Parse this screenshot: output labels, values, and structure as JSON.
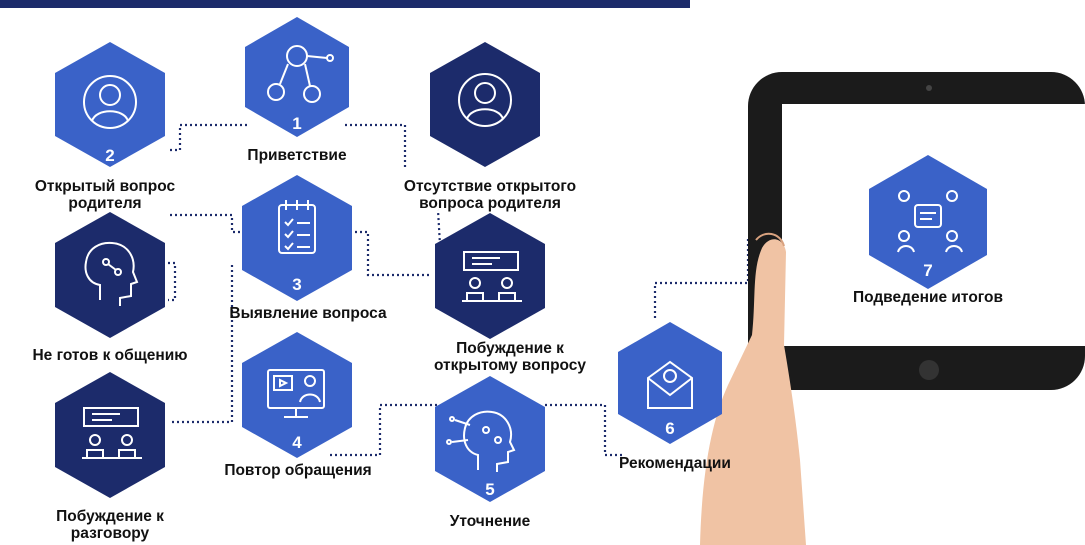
{
  "colors": {
    "accent_light": "#3a62c8",
    "accent_dark": "#1c2b6b",
    "line": "#1c2b6b"
  },
  "nodes": {
    "n1": {
      "number": "1",
      "label": "Приветствие",
      "icon": "people-network-icon"
    },
    "n2": {
      "number": "2",
      "label_line1": "Открытый вопрос",
      "label_line2": "родителя",
      "icon": "user-silhouette-icon"
    },
    "n_absent": {
      "label_line1": "Отсутствие открытого",
      "label_line2": "вопроса родителя",
      "icon": "user-silhouette-icon"
    },
    "n3": {
      "number": "3",
      "label": "Выявление вопроса",
      "icon": "checklist-clipboard-icon"
    },
    "n_notready": {
      "label": "Не готов к общению",
      "icon": "ai-head-icon"
    },
    "n_prompt_open": {
      "label_line1": "Побуждение к",
      "label_line2": "открытому вопросу",
      "icon": "two-people-board-icon"
    },
    "n4": {
      "number": "4",
      "label": "Повтор обращения",
      "icon": "video-call-monitor-icon"
    },
    "n_prompt_talk": {
      "label_line1": "Побуждение к",
      "label_line2": "разговору",
      "icon": "two-people-board-icon"
    },
    "n5": {
      "number": "5",
      "label": "Уточнение",
      "icon": "robot-head-circuit-icon"
    },
    "n6": {
      "number": "6",
      "label": "Рекомендации",
      "icon": "email-envelope-icon"
    },
    "n7": {
      "number": "7",
      "label": "Подведение итогов",
      "icon": "group-chat-icon"
    }
  }
}
